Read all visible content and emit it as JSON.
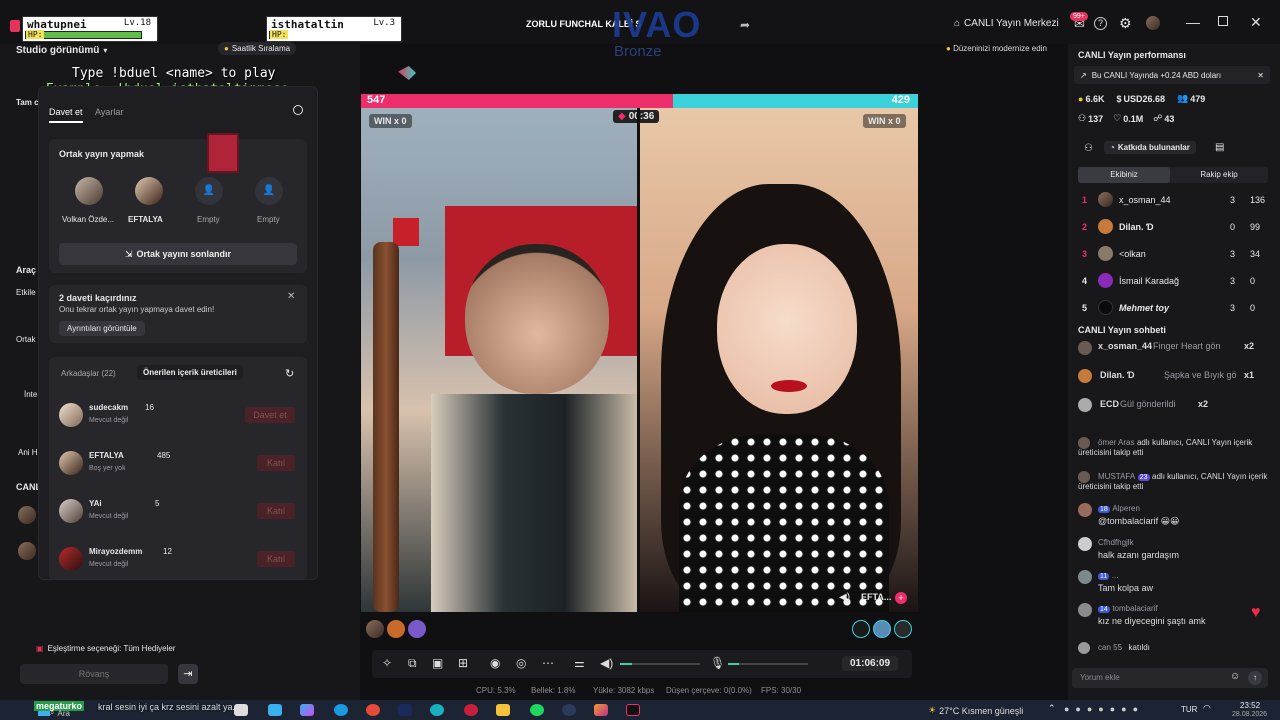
{
  "game_overlay": {
    "player1": {
      "name": "whatupnei",
      "level": "Lv.18",
      "hp_label": "HP:",
      "hp_fill": 0.9
    },
    "player2": {
      "name": "isthataltin",
      "level": "Lv.3",
      "hp_label": "HP:",
      "hp_fill": 0.12
    },
    "instruction": "Type !bduel <name> to play",
    "example": "Example: !bduel isthataltinmese"
  },
  "title_bar": {
    "title": "ZORLU FUNCHAL KALBİ Ş",
    "ivao_logo": "IVAO",
    "ivao_badge": "Bronze",
    "live_center": "CANLI Yayın Merkezi",
    "notif_badge": "99+"
  },
  "left": {
    "studio_view": "Studio görünümü",
    "hourly_ranking": "Saatlik Sıralama",
    "side_labels": [
      "Tam c",
      "Araç",
      "Etkile",
      "Ortak",
      "İnte Oy",
      "Ani Hediy",
      "CANL"
    ],
    "popup": {
      "tabs": [
        "Davet et",
        "Ayarlar"
      ],
      "cohost_title": "Ortak yayın yapmak",
      "slots": [
        {
          "name": "Volkan Özde..."
        },
        {
          "name": "EFTALYA"
        },
        {
          "name": "Empty"
        },
        {
          "name": "Empty"
        }
      ],
      "end_button": "Ortak yayını sonlandır",
      "missed_title": "2 daveti kaçırdınız",
      "missed_text": "Onu tekrar ortak yayın yapmaya davet edin!",
      "details_button": "Ayrıntıları görüntüle",
      "list_tabs": [
        "Arkadaşlar (22)",
        "Önerilen içerik üreticileri"
      ],
      "friends": [
        {
          "name": "sudecakm",
          "count": "16",
          "status": "Mevcut değil",
          "action": "Davet et"
        },
        {
          "name": "EFTALYA",
          "count": "485",
          "status": "Boş yer yok",
          "action": "Katıl"
        },
        {
          "name": "YAi",
          "count": "5",
          "status": "Mevcut değil",
          "action": "Katıl"
        },
        {
          "name": "Mirayozdemm",
          "count": "12",
          "status": "Mevcut değil",
          "action": "Katıl"
        }
      ]
    },
    "match_option": "Eşleştirme seçeneği: Tüm Hediyeler",
    "rovans": "Rövanş",
    "ticker": "kral sesin iyi ça krz sesini azalt ya..",
    "ticker_user": "megaturko"
  },
  "modernize": "Düzeninizi modernize edin",
  "stream": {
    "left_score": "547",
    "right_score": "429",
    "timer": "00:36",
    "win_left": "WIN x 0",
    "win_right": "WIN x 0",
    "right_name": "EFTA...",
    "duration": "01:06:09",
    "stats": {
      "cpu": "CPU: 5.3%",
      "bellek": "Bellek: 1.8%",
      "yukle": "Yükle: 3082 kbps",
      "dusen": "Düşen çerçeve: 0(0.0%)",
      "fps": "FPS: 30/30"
    }
  },
  "right": {
    "perf_title": "CANLI Yayın performansı",
    "banner": "Bu CANLI Yayında +0.24 ABD doları",
    "stats1": [
      "6.6K",
      "USD26.68",
      "479"
    ],
    "stats2": [
      "137",
      "0.1M",
      "43"
    ],
    "contributors": "Katkıda bulunanlar",
    "team_tabs": [
      "Ekibiniz",
      "Rakip ekip"
    ],
    "ranking": [
      {
        "rank": "1",
        "name": "x_osman_44",
        "hearts": "3",
        "score": "136"
      },
      {
        "rank": "2",
        "name": "Dilan. Ɗ",
        "hearts": "0",
        "score": "99"
      },
      {
        "rank": "3",
        "name": "<olkan",
        "hearts": "3",
        "score": "34"
      },
      {
        "rank": "4",
        "name": "İsmail Karadağ",
        "hearts": "3",
        "score": "0"
      },
      {
        "rank": "5",
        "name": "Mehmet toy",
        "hearts": "3",
        "score": "0"
      }
    ],
    "chat_title": "CANLI Yayın sohbeti",
    "gifts": [
      {
        "user": "x_osman_44",
        "text": "Finger Heart gön",
        "mult": "x2"
      },
      {
        "user": "Dilan. Ɗ",
        "text": "Şapka ve Bıyık gö",
        "mult": "x1"
      },
      {
        "user": "ECD",
        "text": "Gül gönderildi",
        "mult": "x2"
      }
    ],
    "chat": [
      {
        "user": "ömer Aras",
        "badge": "",
        "text": "adlı kullanıcı, CANLI Yayın içerik üreticisini takip etti"
      },
      {
        "user": "MUSTAFA",
        "badge": "23",
        "text": "adlı kullanıcı, CANLI Yayın içerik üreticisini takip etti"
      },
      {
        "user": "Alperen",
        "badge": "18",
        "text": "@tombalaciarif 😀😀"
      },
      {
        "user": "Cfhdfhgjlk",
        "badge": "",
        "text": "halk azanı gardaşım"
      },
      {
        "user": "...",
        "badge": "11",
        "text": "Tam kolpa aw"
      },
      {
        "user": "tombalaciarif",
        "badge": "14",
        "text": "kız ne diyecegini şaştı amk"
      },
      {
        "user": "can 55",
        "badge": "",
        "text": "katıldı"
      }
    ],
    "comment_placeholder": "Yorum ekle"
  },
  "taskbar": {
    "search": "Ara",
    "weather": "27°C  Kısmen güneşli",
    "lang": "TUR",
    "time": "23:52",
    "date": "28.08.2026"
  }
}
